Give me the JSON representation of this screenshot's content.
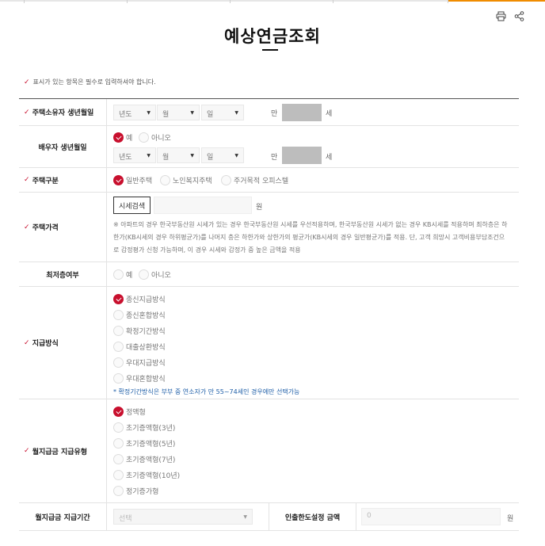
{
  "tools": {
    "print_icon": "print-icon",
    "share_icon": "share-icon"
  },
  "page": {
    "title": "예상연금조회"
  },
  "notice": {
    "text": "표시가 있는 항목은 필수로 입력하셔야 합니다."
  },
  "rows": {
    "owner_birth": {
      "label": "주택소유자 생년월일",
      "year": "년도",
      "month": "월",
      "day": "일",
      "age_prefix": "만",
      "age_suffix": "세"
    },
    "spouse_birth": {
      "label": "배우자 생년월일",
      "yes": "예",
      "no": "아니오",
      "year": "년도",
      "month": "월",
      "day": "일",
      "age_prefix": "만",
      "age_suffix": "세"
    },
    "house_type": {
      "label": "주택구분",
      "opt1": "일반주택",
      "opt2": "노인복지주택",
      "opt3": "주거목적 오피스텔"
    },
    "house_price": {
      "label": "주택가격",
      "search_button": "시세검색",
      "unit": "원",
      "note": "※ 아파트의 경우 한국부동산원 시세가 있는 경우 한국부동산원 시세를 우선적용하며, 한국부동산원 시세가 없는 경우 KB시세를 적용하며 최하층은 하한가(KB시세의 경우 하위평균가)를 나머지 층은 하한가와 상한가의 평균가(KB시세의 경우 일반평균가)를 적용. 단, 고객 희망시 고객비용부담조건으로 감정평가 신청 가능하며, 이 경우 시세와 감정가 중 높은 금액을 적용"
    },
    "lowest_floor": {
      "label": "최저층여부",
      "yes": "예",
      "no": "아니오"
    },
    "payment_method": {
      "label": "지급방식",
      "options": [
        "종신지급방식",
        "종신혼합방식",
        "확정기간방식",
        "대출상환방식",
        "우대지급방식",
        "우대혼합방식"
      ],
      "note": "* 확정기간방식은 부부 중 연소자가 만 55~74세인 경우에만 선택가능"
    },
    "monthly_type": {
      "label": "월지급금 지급유형",
      "options": [
        "정액형",
        "초기증액형(3년)",
        "초기증액형(5년)",
        "초기증액형(7년)",
        "초기증액형(10년)",
        "정기증가형"
      ]
    },
    "monthly_period": {
      "label": "월지급금 지급기간",
      "select": "선택",
      "limit_label": "인출한도설정 금액",
      "limit_value": "0",
      "unit": "원"
    }
  },
  "colors": {
    "accent": "#c8102e",
    "info": "#1f5fa8",
    "top_orange": "#f08c00"
  }
}
